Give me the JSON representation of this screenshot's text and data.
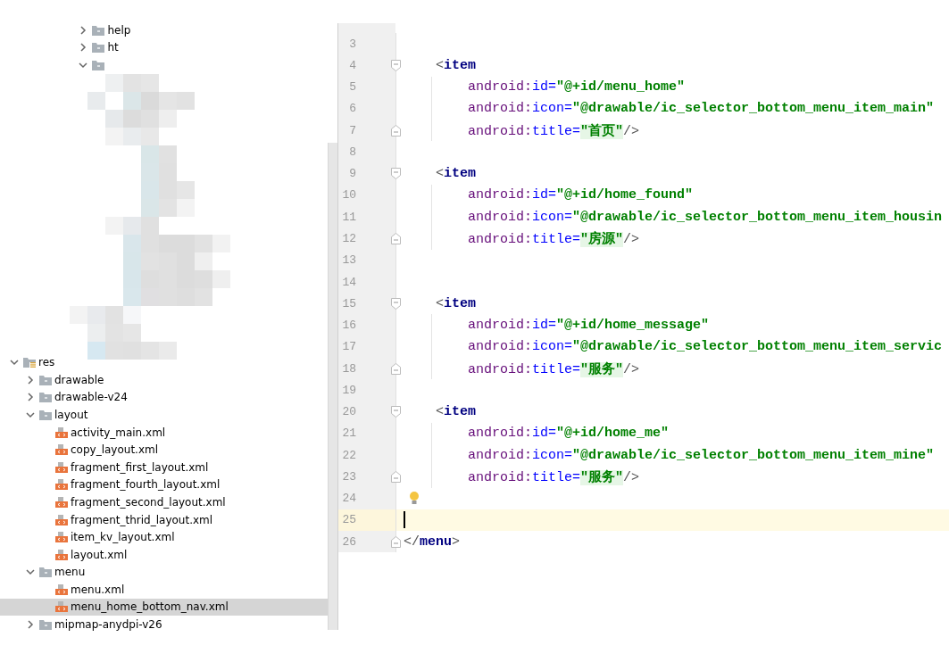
{
  "project_tree": {
    "upper_items": [
      {
        "label": "help",
        "kind": "folder",
        "expanded": false,
        "selected": false
      },
      {
        "label": "ht",
        "kind": "folder",
        "expanded": false,
        "selected": false
      },
      {
        "kind": "folder",
        "expanded": true,
        "selected": false
      }
    ],
    "items": [
      {
        "label": "res",
        "kind": "resource_root",
        "expanded": true,
        "selected": false,
        "children": [
          {
            "label": "drawable",
            "kind": "folder",
            "expanded": false,
            "selected": false
          },
          {
            "label": "drawable-v24",
            "kind": "folder",
            "expanded": false,
            "selected": false
          },
          {
            "label": "layout",
            "kind": "folder",
            "expanded": true,
            "selected": false,
            "children": [
              {
                "label": "activity_main.xml",
                "kind": "xml_file",
                "selected": false
              },
              {
                "label": "copy_layout.xml",
                "kind": "xml_file",
                "selected": false
              },
              {
                "label": "fragment_first_layout.xml",
                "kind": "xml_file",
                "selected": false
              },
              {
                "label": "fragment_fourth_layout.xml",
                "kind": "xml_file",
                "selected": false
              },
              {
                "label": "fragment_second_layout.xml",
                "kind": "xml_file",
                "selected": false
              },
              {
                "label": "fragment_thrid_layout.xml",
                "kind": "xml_file",
                "selected": false
              },
              {
                "label": "item_kv_layout.xml",
                "kind": "xml_file",
                "selected": false
              },
              {
                "label": "layout.xml",
                "kind": "xml_file",
                "selected": false
              }
            ]
          },
          {
            "label": "menu",
            "kind": "folder",
            "expanded": true,
            "selected": false,
            "children": [
              {
                "label": "menu.xml",
                "kind": "xml_file",
                "selected": false
              },
              {
                "label": "menu_home_bottom_nav.xml",
                "kind": "xml_file",
                "selected": true
              }
            ]
          },
          {
            "label": "mipmap-anydpi-v26",
            "kind": "folder",
            "expanded": false,
            "selected": false
          }
        ]
      }
    ]
  },
  "editor": {
    "lines": [
      {
        "number": "3",
        "kind": "blank",
        "current": false,
        "bulb": false
      },
      {
        "number": "4",
        "kind": "element_open",
        "fold_marker": {
          "kind": "start"
        },
        "current": false,
        "bulb": false,
        "tokens": [
          {
            "kind": "bracket",
            "text": "<"
          },
          {
            "kind": "tag",
            "text": "item"
          }
        ]
      },
      {
        "number": "5",
        "kind": "attribute",
        "current": false,
        "bulb": false,
        "tokens": [
          {
            "kind": "ns",
            "text": "android:"
          },
          {
            "kind": "attr",
            "text": "id"
          },
          {
            "kind": "eq",
            "text": "="
          },
          {
            "kind": "value",
            "text": "\"@+id/menu_home\""
          }
        ]
      },
      {
        "number": "6",
        "kind": "attribute",
        "current": false,
        "bulb": false,
        "tokens": [
          {
            "kind": "ns",
            "text": "android:"
          },
          {
            "kind": "attr",
            "text": "icon"
          },
          {
            "kind": "eq",
            "text": "="
          },
          {
            "kind": "value",
            "text": "\"@drawable/ic_selector_bottom_menu_item_main\""
          }
        ]
      },
      {
        "number": "7",
        "kind": "attribute",
        "fold_marker": {
          "kind": "end"
        },
        "current": false,
        "bulb": false,
        "tokens": [
          {
            "kind": "ns",
            "text": "android:"
          },
          {
            "kind": "attr",
            "text": "title"
          },
          {
            "kind": "eq",
            "text": "="
          },
          {
            "kind": "hvalue",
            "text": "\"首页\""
          },
          {
            "kind": "bracket",
            "text": "/>"
          }
        ]
      },
      {
        "number": "8",
        "kind": "blank",
        "current": false,
        "bulb": false
      },
      {
        "number": "9",
        "kind": "element_open",
        "fold_marker": {
          "kind": "start"
        },
        "current": false,
        "bulb": false,
        "tokens": [
          {
            "kind": "bracket",
            "text": "<"
          },
          {
            "kind": "tag",
            "text": "item"
          }
        ]
      },
      {
        "number": "10",
        "kind": "attribute",
        "current": false,
        "bulb": false,
        "tokens": [
          {
            "kind": "ns",
            "text": "android:"
          },
          {
            "kind": "attr",
            "text": "id"
          },
          {
            "kind": "eq",
            "text": "="
          },
          {
            "kind": "value",
            "text": "\"@+id/home_found\""
          }
        ]
      },
      {
        "number": "11",
        "kind": "attribute",
        "current": false,
        "bulb": false,
        "tokens": [
          {
            "kind": "ns",
            "text": "android:"
          },
          {
            "kind": "attr",
            "text": "icon"
          },
          {
            "kind": "eq",
            "text": "="
          },
          {
            "kind": "value",
            "text": "\"@drawable/ic_selector_bottom_menu_item_housin"
          }
        ]
      },
      {
        "number": "12",
        "kind": "attribute",
        "fold_marker": {
          "kind": "end"
        },
        "current": false,
        "bulb": false,
        "tokens": [
          {
            "kind": "ns",
            "text": "android:"
          },
          {
            "kind": "attr",
            "text": "title"
          },
          {
            "kind": "eq",
            "text": "="
          },
          {
            "kind": "hvalue",
            "text": "\"房源\""
          },
          {
            "kind": "bracket",
            "text": "/>"
          }
        ]
      },
      {
        "number": "13",
        "kind": "blank",
        "current": false,
        "bulb": false
      },
      {
        "number": "14",
        "kind": "blank",
        "current": false,
        "bulb": false
      },
      {
        "number": "15",
        "kind": "element_open",
        "fold_marker": {
          "kind": "start"
        },
        "current": false,
        "bulb": false,
        "tokens": [
          {
            "kind": "bracket",
            "text": "<"
          },
          {
            "kind": "tag",
            "text": "item"
          }
        ]
      },
      {
        "number": "16",
        "kind": "attribute",
        "current": false,
        "bulb": false,
        "tokens": [
          {
            "kind": "ns",
            "text": "android:"
          },
          {
            "kind": "attr",
            "text": "id"
          },
          {
            "kind": "eq",
            "text": "="
          },
          {
            "kind": "value",
            "text": "\"@+id/home_message\""
          }
        ]
      },
      {
        "number": "17",
        "kind": "attribute",
        "current": false,
        "bulb": false,
        "tokens": [
          {
            "kind": "ns",
            "text": "android:"
          },
          {
            "kind": "attr",
            "text": "icon"
          },
          {
            "kind": "eq",
            "text": "="
          },
          {
            "kind": "value",
            "text": "\"@drawable/ic_selector_bottom_menu_item_servic"
          }
        ]
      },
      {
        "number": "18",
        "kind": "attribute",
        "fold_marker": {
          "kind": "end"
        },
        "current": false,
        "bulb": false,
        "tokens": [
          {
            "kind": "ns",
            "text": "android:"
          },
          {
            "kind": "attr",
            "text": "title"
          },
          {
            "kind": "eq",
            "text": "="
          },
          {
            "kind": "hvalue",
            "text": "\"服务\""
          },
          {
            "kind": "bracket",
            "text": "/>"
          }
        ]
      },
      {
        "number": "19",
        "kind": "blank",
        "current": false,
        "bulb": false
      },
      {
        "number": "20",
        "kind": "element_open",
        "fold_marker": {
          "kind": "start"
        },
        "current": false,
        "bulb": false,
        "tokens": [
          {
            "kind": "bracket",
            "text": "<"
          },
          {
            "kind": "tag",
            "text": "item"
          }
        ]
      },
      {
        "number": "21",
        "kind": "attribute",
        "current": false,
        "bulb": false,
        "tokens": [
          {
            "kind": "ns",
            "text": "android:"
          },
          {
            "kind": "attr",
            "text": "id"
          },
          {
            "kind": "eq",
            "text": "="
          },
          {
            "kind": "value",
            "text": "\"@+id/home_me\""
          }
        ]
      },
      {
        "number": "22",
        "kind": "attribute",
        "current": false,
        "bulb": false,
        "tokens": [
          {
            "kind": "ns",
            "text": "android:"
          },
          {
            "kind": "attr",
            "text": "icon"
          },
          {
            "kind": "eq",
            "text": "="
          },
          {
            "kind": "value",
            "text": "\"@drawable/ic_selector_bottom_menu_item_mine\""
          }
        ]
      },
      {
        "number": "23",
        "kind": "attribute",
        "fold_marker": {
          "kind": "end"
        },
        "current": false,
        "bulb": false,
        "tokens": [
          {
            "kind": "ns",
            "text": "android:"
          },
          {
            "kind": "attr",
            "text": "title"
          },
          {
            "kind": "eq",
            "text": "="
          },
          {
            "kind": "hvalue",
            "text": "\"服务\""
          },
          {
            "kind": "bracket",
            "text": "/>"
          }
        ]
      },
      {
        "number": "24",
        "kind": "blank",
        "current": false,
        "bulb": true
      },
      {
        "number": "25",
        "kind": "blank",
        "current": true,
        "bulb": false
      },
      {
        "number": "26",
        "kind": "root_close",
        "fold_marker": {
          "kind": "end"
        },
        "current": false,
        "bulb": false,
        "tokens": [
          {
            "kind": "bracket",
            "text": "</"
          },
          {
            "kind": "tag",
            "text": "menu"
          },
          {
            "kind": "bracket",
            "text": ">"
          }
        ]
      }
    ]
  }
}
